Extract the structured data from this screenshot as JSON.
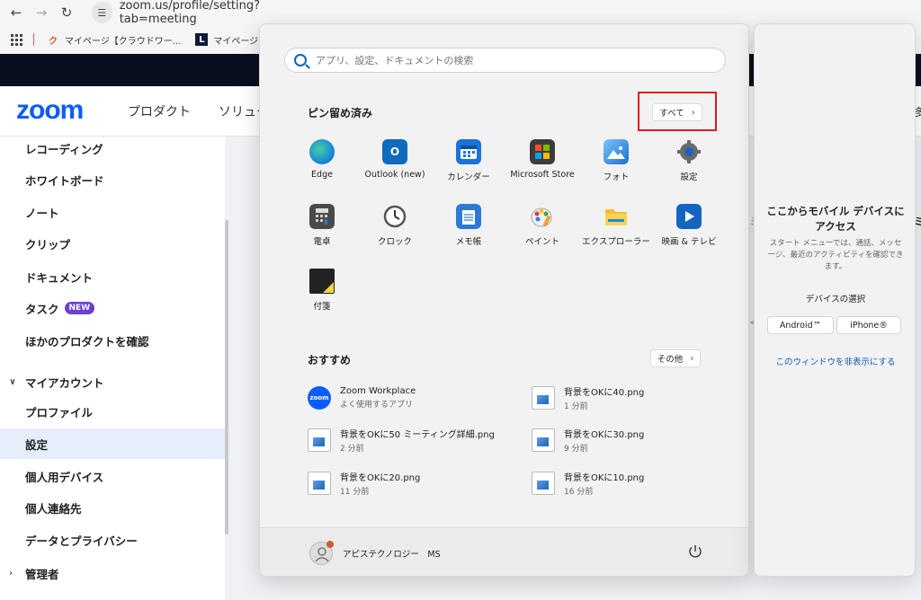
{
  "browser": {
    "url": "zoom.us/profile/setting?tab=meeting",
    "bookmarks": [
      {
        "label": "マイページ【クラウドワー...",
        "icon": "crowdworks-icon"
      },
      {
        "label": "マイページ | クラウドソー",
        "icon": "lancers-icon"
      }
    ]
  },
  "zoom": {
    "logo": "zoom",
    "nav": [
      "プロダクト",
      "ソリュー"
    ],
    "sidebar": {
      "items": [
        {
          "label": "レコーディング"
        },
        {
          "label": "ホワイトボード"
        },
        {
          "label": "ノート"
        },
        {
          "label": "クリップ"
        },
        {
          "label": "ドキュメント"
        },
        {
          "label": "タスク",
          "badge": "NEW"
        },
        {
          "label": "ほかのプロダクトを確認"
        },
        {
          "label": "マイアカウント",
          "group": true
        },
        {
          "label": "プロファイル"
        },
        {
          "label": "設定",
          "active": true
        },
        {
          "label": "個人用デバイス"
        },
        {
          "label": "個人連絡先"
        },
        {
          "label": "データとプライバシー"
        },
        {
          "label": "管理者",
          "group": true
        }
      ]
    },
    "right_fragments": [
      "多",
      "ミ",
      "<"
    ]
  },
  "start_menu": {
    "search_placeholder": "アプリ、設定、ドキュメントの検索",
    "pinned_title": "ピン留め済み",
    "all_button": "すべて",
    "pinned_apps": [
      {
        "label": "Edge",
        "icon": "edge-icon",
        "color": "#1f8ad6"
      },
      {
        "label": "Outlook (new)",
        "icon": "outlook-icon",
        "color": "#0f6cbd"
      },
      {
        "label": "カレンダー",
        "icon": "calendar-icon",
        "color": "#1a73d9"
      },
      {
        "label": "Microsoft Store",
        "icon": "store-icon",
        "color": "#3b3b3b"
      },
      {
        "label": "フォト",
        "icon": "photos-icon",
        "color": "#2e86de"
      },
      {
        "label": "設定",
        "icon": "settings-icon",
        "color": "#6b6b6b"
      },
      {
        "label": "電卓",
        "icon": "calculator-icon",
        "color": "#4a4a4a"
      },
      {
        "label": "クロック",
        "icon": "clock-icon",
        "color": "#555555"
      },
      {
        "label": "メモ帳",
        "icon": "notepad-icon",
        "color": "#2b7bd6"
      },
      {
        "label": "ペイント",
        "icon": "paint-icon",
        "color": "#f0a030"
      },
      {
        "label": "エクスプローラー",
        "icon": "explorer-icon",
        "color": "#f5c02e"
      },
      {
        "label": "映画 & テレビ",
        "icon": "movies-icon",
        "color": "#1565c0"
      },
      {
        "label": "付箋",
        "icon": "sticky-notes-icon",
        "color": "#222222"
      }
    ],
    "recommended_title": "おすすめ",
    "more_button": "その他",
    "recommended": [
      {
        "name": "Zoom Workplace",
        "sub": "よく使用するアプリ",
        "icon": "zoom-app-icon"
      },
      {
        "name": "背景をOKに40.png",
        "sub": "1 分前",
        "icon": "image-file-icon"
      },
      {
        "name": "背景をOKに50 ミーティング詳細.png",
        "sub": "2 分前",
        "icon": "image-file-icon"
      },
      {
        "name": "背景をOKに30.png",
        "sub": "9 分前",
        "icon": "image-file-icon"
      },
      {
        "name": "背景をOKに20.png",
        "sub": "11 分前",
        "icon": "image-file-icon"
      },
      {
        "name": "背景をOKに10.png",
        "sub": "16 分前",
        "icon": "image-file-icon"
      }
    ],
    "user_name": "アピステクノロジー　MS"
  },
  "phone_panel": {
    "title": "ここからモバイル デバイスにアクセス",
    "description": "スタート メニューでは、通話、メッセージ、最近のアクティビティを確認できます。",
    "subtitle": "デバイスの選択",
    "buttons": [
      "Android™",
      "iPhone®"
    ],
    "hide_link": "このウィンドウを非表示にする"
  }
}
